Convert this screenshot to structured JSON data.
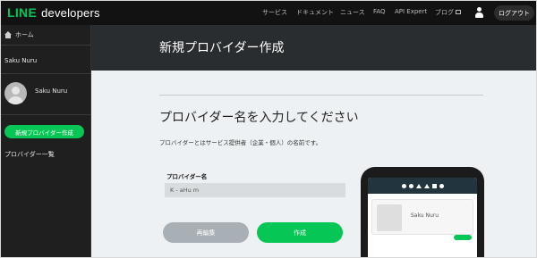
{
  "header": {
    "logo_line": "LINE",
    "logo_developers": "developers",
    "nav": [
      {
        "label": "サービス"
      },
      {
        "label": "ドキュメント"
      },
      {
        "label": "ニュース"
      },
      {
        "label": "FAQ"
      },
      {
        "label": "API Expert"
      },
      {
        "label": "ブログ"
      }
    ],
    "logout_label": "ログアウト"
  },
  "sidebar": {
    "home_label": "ホーム",
    "provider_name": "Saku Nuru",
    "user_name": "Saku Nuru",
    "new_provider_button": "新規プロバイダー作成",
    "provider_list_link": "プロバイダー一覧"
  },
  "main": {
    "page_title": "新規プロバイダー作成",
    "section_title": "プロバイダー名を入力してください",
    "description": "プロバイダーとはサービス提供者（企業・個人）の名前です。",
    "field_label": "プロバイダー名",
    "field_value": "K - aHu m",
    "cancel_button": "再編集",
    "create_button": "作成"
  },
  "preview": {
    "card_text": "Saku Nuru"
  },
  "colors": {
    "brand_green": "#06c755",
    "topbar": "#121212",
    "sidebar": "#1f1f1f",
    "header": "#2a2d2f"
  }
}
